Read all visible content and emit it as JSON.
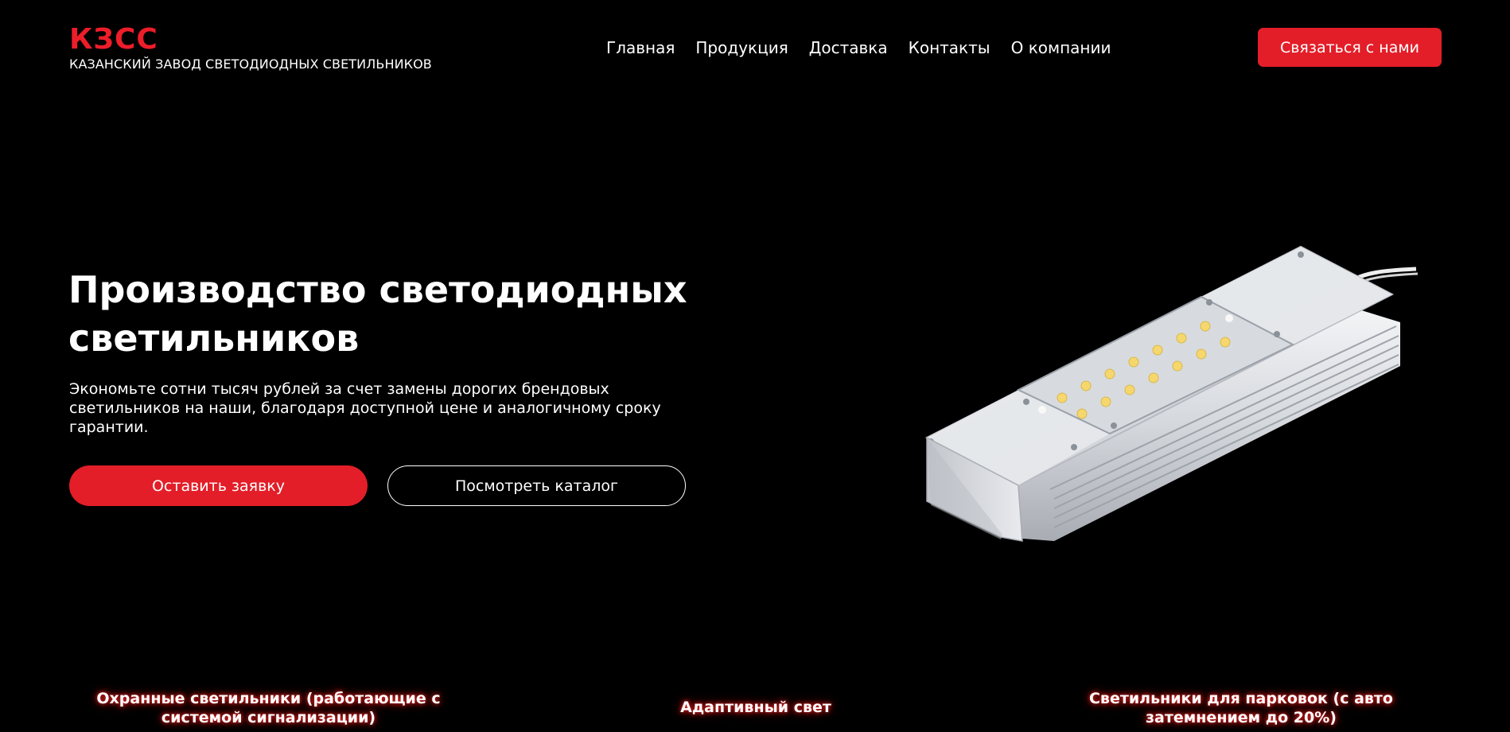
{
  "brand": {
    "name": "КЗСС",
    "tagline": "КАЗАНСКИЙ ЗАВОД СВЕТОДИОДНЫХ СВЕТИЛЬНИКОВ"
  },
  "nav": {
    "items": [
      {
        "label": "Главная"
      },
      {
        "label": "Продукция"
      },
      {
        "label": "Доставка"
      },
      {
        "label": "Контакты"
      },
      {
        "label": "О компании"
      }
    ]
  },
  "header": {
    "contact_button_label": "Связаться с нами"
  },
  "hero": {
    "title": "Производство светодиодных светильников",
    "description": "Экономьте сотни тысяч рублей за счет замены дорогих брендовых светильников на наши, благодаря доступной цене и аналогичному сроку гарантии.",
    "primary_button_label": "Оставить заявку",
    "secondary_button_label": "Посмотреть каталог"
  },
  "features": [
    {
      "label": "Охранные светильники (работающие с системой сигнализации)"
    },
    {
      "label": "Адаптивный свет"
    },
    {
      "label": "Светильники для парковок (с авто затемнением до 20%)"
    }
  ],
  "colors": {
    "accent": "#e31e28",
    "background": "#000000",
    "text": "#ffffff"
  }
}
